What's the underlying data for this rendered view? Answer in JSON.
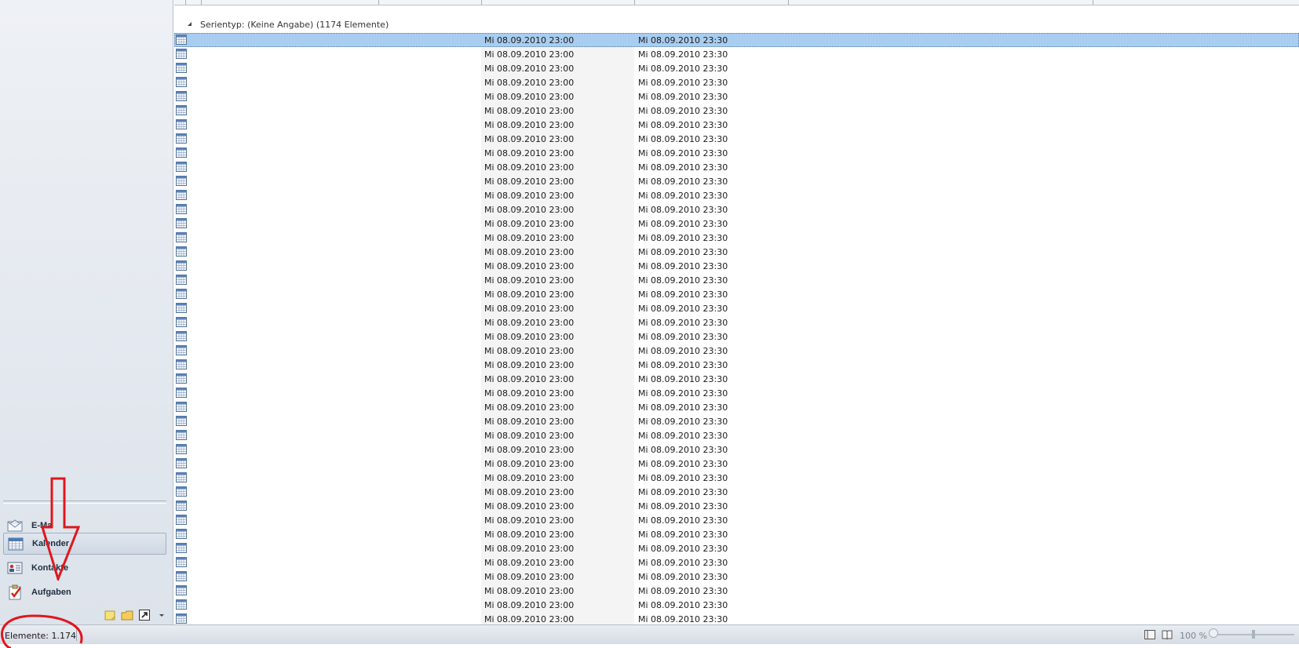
{
  "navigation": {
    "items": [
      {
        "label": "E-Ma",
        "icon": "mail-icon",
        "active": false
      },
      {
        "label": "Kalender",
        "icon": "calendar-icon",
        "active": true
      },
      {
        "label": "Kontakte",
        "icon": "contacts-icon",
        "active": false
      },
      {
        "label": "Aufgaben",
        "icon": "tasks-icon",
        "active": false
      }
    ],
    "mini_tools": [
      "notes-icon",
      "folder-icon",
      "shortcut-icon",
      "configure-buttons-icon"
    ]
  },
  "list": {
    "group_header": "Serientyp: (Keine Angabe) (1174 Elemente)",
    "row_start": "Mi 08.09.2010 23:00",
    "row_end": "Mi 08.09.2010 23:30",
    "visible_rows": 42,
    "selected_row": 0
  },
  "status_bar": {
    "item_count": "Elemente: 1.174",
    "zoom": "100 %",
    "view_buttons": [
      "normal-view-icon",
      "reading-view-icon"
    ]
  },
  "colors": {
    "selection": "#a9cdf0",
    "annotation": "#e0161d"
  }
}
